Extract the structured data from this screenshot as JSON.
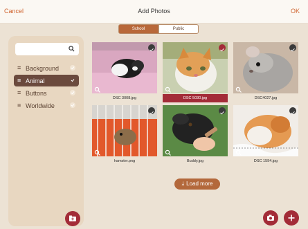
{
  "header": {
    "cancel": "Cancel",
    "title": "Add Photos",
    "ok": "OK"
  },
  "segments": {
    "active": "School",
    "inactive": "Public"
  },
  "sidebar": {
    "search": {
      "placeholder": ""
    },
    "categories": [
      {
        "label": "Background",
        "selected": false
      },
      {
        "label": "Animal",
        "selected": true
      },
      {
        "label": "Buttons",
        "selected": false
      },
      {
        "label": "Worldwide",
        "selected": false
      }
    ]
  },
  "photos": [
    {
      "name": "DSC 3008.jpg",
      "selected": false
    },
    {
      "name": "DSC 5030.jpg",
      "selected": true
    },
    {
      "name": "DSC4027.jpg",
      "selected": false
    },
    {
      "name": "hamster.png",
      "selected": false
    },
    {
      "name": "Buddy.jpg",
      "selected": false
    },
    {
      "name": "DSC 1594.jpg",
      "selected": false
    }
  ],
  "load_more": "Load more",
  "colors": {
    "accent": "#a32c38",
    "brand": "#b3683b",
    "panel": "#e8d7c1",
    "background": "#ece2d4"
  }
}
